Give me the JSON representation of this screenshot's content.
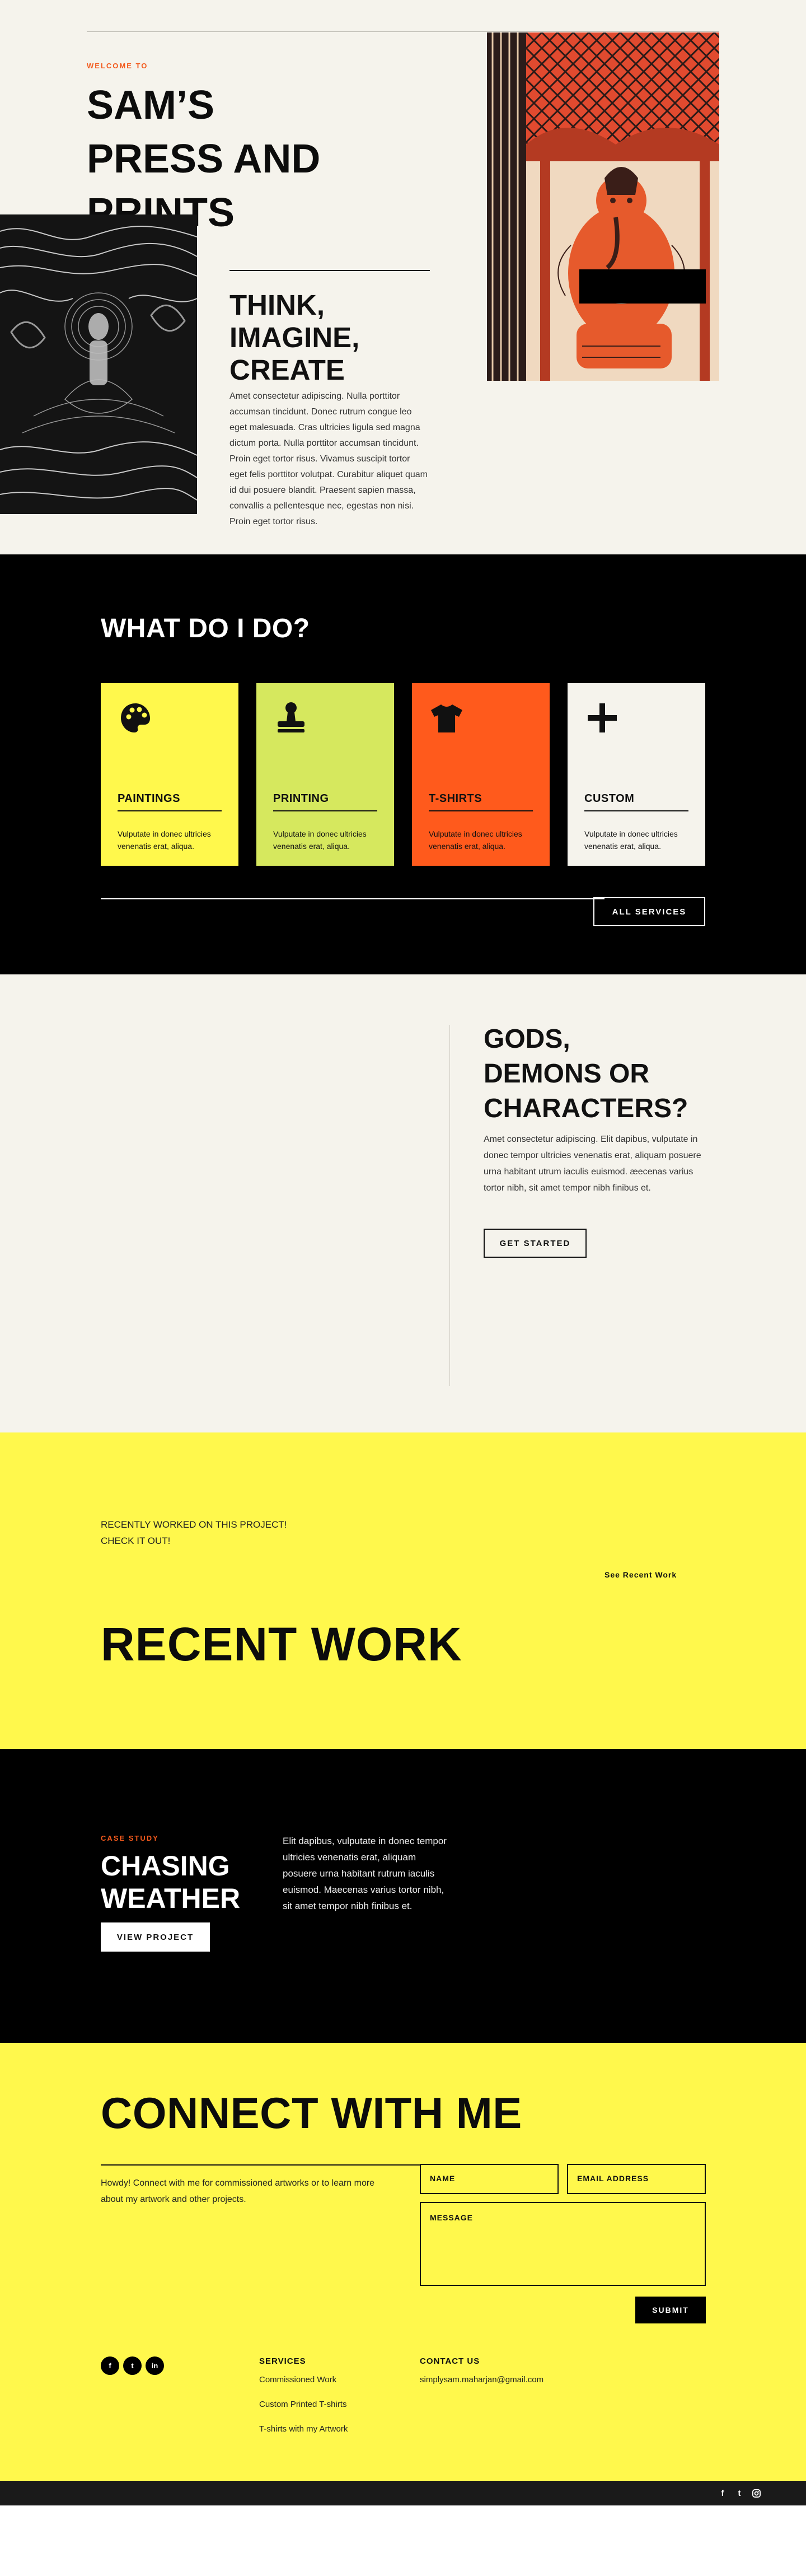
{
  "hero": {
    "eyebrow": "WELCOME TO",
    "title_lines": [
      "SAM’S",
      "PRESS AND",
      "PRINTS"
    ],
    "subtitle_lines": [
      "THINK,",
      "IMAGINE,",
      "CREATE"
    ],
    "body": "Amet consectetur adipiscing. Nulla porttitor accumsan tincidunt. Donec rutrum congue leo eget malesuada. Cras ultricies ligula sed magna dictum porta. Nulla porttitor accumsan tincidunt. Proin eget tortor risus. Vivamus suscipit tortor eget felis porttitor volutpat. Curabitur aliquet quam id dui posuere blandit. Praesent sapien massa, convallis a pellentesque nec, egestas non nisi. Proin eget tortor risus."
  },
  "services": {
    "heading": "WHAT DO I DO?",
    "cards": [
      {
        "title": "PAINTINGS",
        "desc": "Vulputate in donec ultricies venenatis erat, aliqua.",
        "icon": "palette-icon",
        "bg": "#fff84c"
      },
      {
        "title": "PRINTING",
        "desc": "Vulputate in donec ultricies venenatis erat, aliqua.",
        "icon": "stamp-icon",
        "bg": "#d6e85e"
      },
      {
        "title": "T-SHIRTS",
        "desc": "Vulputate in donec ultricies venenatis erat, aliqua.",
        "icon": "tshirt-icon",
        "bg": "#ff5a1c"
      },
      {
        "title": "CUSTOM",
        "desc": "Vulputate in donec ultricies venenatis erat, aliqua.",
        "icon": "plus-icon",
        "bg": "#f5f3ec"
      }
    ],
    "all_services_label": "ALL SERVICES"
  },
  "gods": {
    "heading_lines": [
      "GODS,",
      "DEMONS OR",
      "CHARACTERS?"
    ],
    "body": "Amet consectetur adipiscing. Elit dapibus, vulputate in donec tempor ultricies venenatis erat, aliquam posuere urna habitant utrum iaculis euismod. æecenas varius tortor nibh, sit amet tempor nibh finibus et.",
    "button_label": "GET STARTED"
  },
  "recent": {
    "note_lines": [
      "RECENTLY WORKED ON THIS PROJECT!",
      "CHECK IT OUT!"
    ],
    "see_label": "See Recent Work",
    "heading": "RECENT WORK"
  },
  "case_study": {
    "eyebrow": "CASE STUDY",
    "heading_lines": [
      "CHASING",
      "WEATHER"
    ],
    "button_label": "VIEW PROJECT",
    "body": "Elit dapibus, vulputate in donec tempor ultricies venenatis erat, aliquam posuere urna habitant rutrum iaculis euismod. Maecenas varius tortor nibh, sit amet tempor nibh finibus et."
  },
  "contact": {
    "heading": "CONNECT WITH ME",
    "intro": "Howdy! Connect with me for commissioned artworks or to learn more about my artwork and other projects.",
    "name_label": "NAME",
    "email_label": "EMAIL ADDRESS",
    "message_label": "MESSAGE",
    "submit_label": "SUBMIT"
  },
  "footer": {
    "social": [
      "facebook-icon",
      "twitter-icon",
      "linkedin-icon"
    ],
    "services_heading": "SERVICES",
    "services_links": [
      "Commissioned Work",
      "Custom Printed T-shirts",
      "T-shirts with my Artwork"
    ],
    "contact_heading": "CONTACT US",
    "email": "simplysam.maharjan@gmail.com",
    "bottom_icons": [
      "facebook-icon",
      "twitter-icon",
      "instagram-icon"
    ]
  },
  "colors": {
    "accent_orange": "#f2591c",
    "yellow": "#fff84c",
    "lime": "#d6e85e",
    "orange": "#ff5a1c",
    "cream": "#f5f3ec",
    "black": "#000000"
  }
}
